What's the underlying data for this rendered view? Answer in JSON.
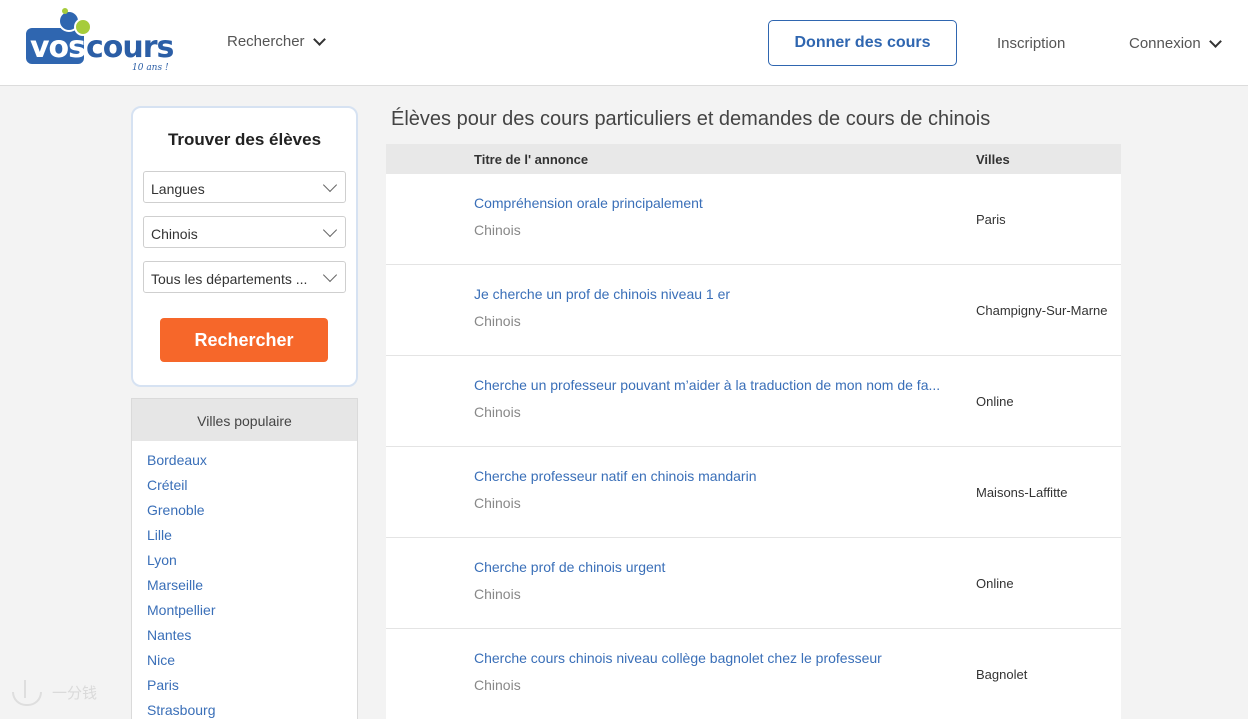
{
  "header": {
    "logo_text_a": "vos",
    "logo_text_b": "cours",
    "logo_tagline": "10 ans !",
    "nav_search": "Rechercher",
    "cta": "Donner des cours",
    "signup": "Inscription",
    "login": "Connexion"
  },
  "search": {
    "title": "Trouver des élèves",
    "category": "Langues",
    "subject": "Chinois",
    "department": "Tous les départements ...",
    "button": "Rechercher"
  },
  "cities": {
    "heading": "Villes populaire",
    "items": [
      "Bordeaux",
      "Créteil",
      "Grenoble",
      "Lille",
      "Lyon",
      "Marseille",
      "Montpellier",
      "Nantes",
      "Nice",
      "Paris",
      "Strasbourg"
    ]
  },
  "main": {
    "title": "Élèves pour des cours particuliers et demandes de cours de chinois",
    "col_title": "Titre de l' annonce",
    "col_city": "Villes",
    "rows": [
      {
        "title": "Compréhension orale principalement",
        "subject": "Chinois",
        "city": "Paris"
      },
      {
        "title": "Je cherche un prof de chinois niveau 1 er",
        "subject": "Chinois",
        "city": "Champigny-Sur-Marne"
      },
      {
        "title": "Cherche un professeur pouvant m’aider à la traduction de mon nom de fa...",
        "subject": "Chinois",
        "city": "Online"
      },
      {
        "title": "Cherche professeur natif en chinois mandarin",
        "subject": "Chinois",
        "city": "Maisons-Laffitte"
      },
      {
        "title": "Cherche prof de chinois urgent",
        "subject": "Chinois",
        "city": "Online"
      },
      {
        "title": "Cherche cours chinois niveau collège bagnolet chez le professeur",
        "subject": "Chinois",
        "city": "Bagnolet"
      }
    ]
  },
  "watermark": {
    "text": "一分钱"
  },
  "colors": {
    "brand_blue": "#2f66b0",
    "link_blue": "#3a6fb8",
    "accent_orange": "#f6672a",
    "logo_green": "#a6cc3b"
  }
}
